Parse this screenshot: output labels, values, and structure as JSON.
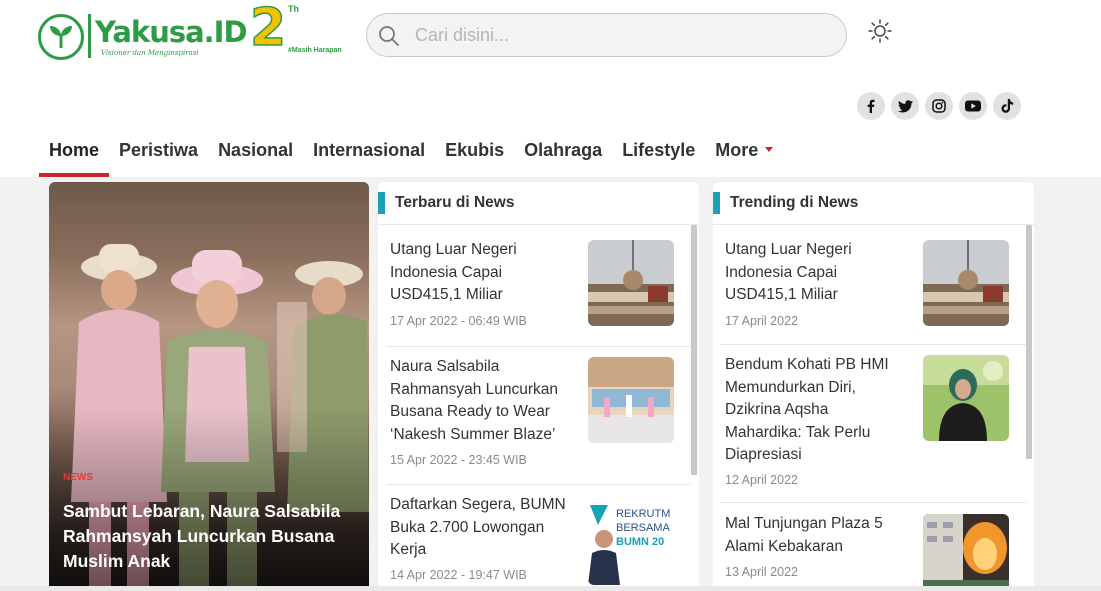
{
  "logo": {
    "wordmark": "Yakusa.ID",
    "tagline": "Visioner dan Menginspirasi",
    "anniversary_number": "2",
    "anniversary_suffix": "Th",
    "anniversary_tag": "#Masih Harapan"
  },
  "search": {
    "placeholder": "Cari disini..."
  },
  "social": [
    "facebook",
    "twitter",
    "instagram",
    "youtube",
    "tiktok"
  ],
  "nav": {
    "items": [
      "Home",
      "Peristiwa",
      "Nasional",
      "Internasional",
      "Ekubis",
      "Olahraga",
      "Lifestyle",
      "More"
    ],
    "active": "Home"
  },
  "hero": {
    "category": "NEWS",
    "title": "Sambut Lebaran, Naura Salsabila Rahmansyah Luncurkan Busana Muslim Anak"
  },
  "latest": {
    "heading": "Terbaru di News",
    "items": [
      {
        "title": "Utang Luar Negeri Indonesia Capai USD415,1 Miliar",
        "meta": "17 Apr 2022 - 06:49 WIB"
      },
      {
        "title": "Naura Salsabila Rahmansyah Luncurkan Busana Ready to Wear ‘Nakesh Summer Blaze’",
        "meta": "15 Apr 2022 - 23:45 WIB"
      },
      {
        "title": "Daftarkan Segera, BUMN Buka 2.700 Lowongan Kerja",
        "meta": "14 Apr 2022 - 19:47 WIB"
      }
    ],
    "thumb3_text": [
      "REKRUTM",
      "BERSAMA",
      "BUMN 20"
    ]
  },
  "trending": {
    "heading": "Trending di News",
    "items": [
      {
        "title": "Utang Luar Negeri Indonesia Capai USD415,1 Miliar",
        "meta": "17 April 2022"
      },
      {
        "title": "Bendum Kohati PB HMI Memundurkan Diri, Dzikrina Aqsha Mahardika: Tak Perlu Diapresiasi",
        "meta": "12 April 2022"
      },
      {
        "title": "Mal Tunjungan Plaza 5 Alami Kebakaran",
        "meta": "13 April 2022"
      }
    ]
  },
  "colors": {
    "brand_green": "#2e9c46",
    "accent_red": "#c8262e",
    "section_teal": "#1aa0b5"
  }
}
